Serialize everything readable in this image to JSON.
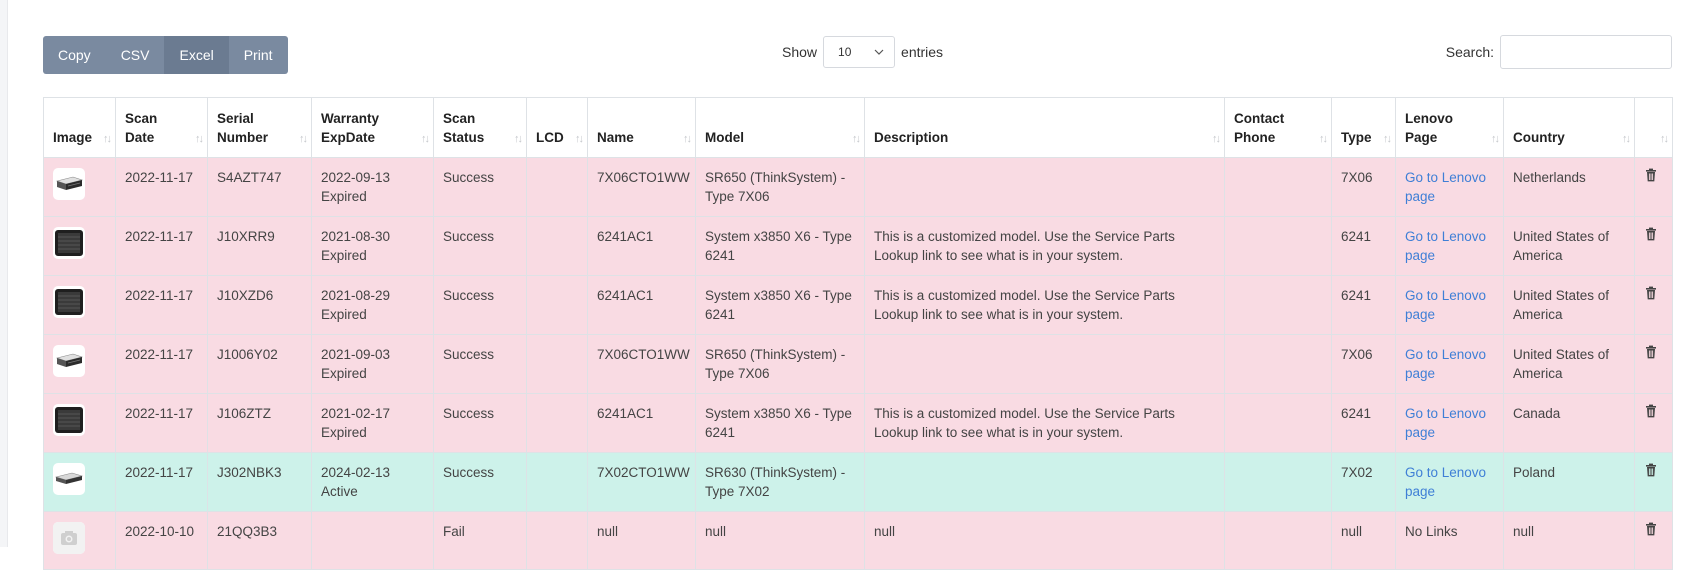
{
  "toolbar": {
    "buttons": [
      "Copy",
      "CSV",
      "Excel",
      "Print"
    ]
  },
  "length": {
    "show_label": "Show",
    "value": "10",
    "entries_label": "entries"
  },
  "search": {
    "label": "Search:",
    "value": ""
  },
  "table": {
    "headers": [
      "Image",
      "Scan Date",
      "Serial Number",
      "Warranty ExpDate",
      "Scan Status",
      "LCD",
      "Name",
      "Model",
      "Description",
      "Contact Phone",
      "Type",
      "Lenovo Page",
      "Country",
      ""
    ],
    "rows": [
      {
        "status": "expired",
        "image": "rack-server-light",
        "scan_date": "2022-11-17",
        "serial": "S4AZT747",
        "warranty": "2022-09-13",
        "warranty_state": "Expired",
        "scan_status": "Success",
        "lcd": "",
        "name": "7X06CTO1WW",
        "model": "SR650 (ThinkSystem) - Type 7X06",
        "description": "",
        "phone": "",
        "type": "7X06",
        "lenovo": "Go to Lenovo page",
        "lenovo_link": true,
        "country": "Netherlands"
      },
      {
        "status": "expired",
        "image": "server-dark",
        "scan_date": "2022-11-17",
        "serial": "J10XRR9",
        "warranty": "2021-08-30",
        "warranty_state": "Expired",
        "scan_status": "Success",
        "lcd": "",
        "name": "6241AC1",
        "model": "System x3850 X6 - Type 6241",
        "description": "This is a customized model. Use the Service Parts Lookup link to see what is in your system.",
        "phone": "",
        "type": "6241",
        "lenovo": "Go to Lenovo page",
        "lenovo_link": true,
        "country": "United States of America"
      },
      {
        "status": "expired",
        "image": "server-dark",
        "scan_date": "2022-11-17",
        "serial": "J10XZD6",
        "warranty": "2021-08-29",
        "warranty_state": "Expired",
        "scan_status": "Success",
        "lcd": "",
        "name": "6241AC1",
        "model": "System x3850 X6 - Type 6241",
        "description": "This is a customized model. Use the Service Parts Lookup link to see what is in your system.",
        "phone": "",
        "type": "6241",
        "lenovo": "Go to Lenovo page",
        "lenovo_link": true,
        "country": "United States of America"
      },
      {
        "status": "expired",
        "image": "rack-server-light",
        "scan_date": "2022-11-17",
        "serial": "J1006Y02",
        "warranty": "2021-09-03",
        "warranty_state": "Expired",
        "scan_status": "Success",
        "lcd": "",
        "name": "7X06CTO1WW",
        "model": "SR650 (ThinkSystem) - Type 7X06",
        "description": "",
        "phone": "",
        "type": "7X06",
        "lenovo": "Go to Lenovo page",
        "lenovo_link": true,
        "country": "United States of America"
      },
      {
        "status": "expired",
        "image": "server-dark",
        "scan_date": "2022-11-17",
        "serial": "J106ZTZ",
        "warranty": "2021-02-17",
        "warranty_state": "Expired",
        "scan_status": "Success",
        "lcd": "",
        "name": "6241AC1",
        "model": "System x3850 X6 - Type 6241",
        "description": "This is a customized model. Use the Service Parts Lookup link to see what is in your system.",
        "phone": "",
        "type": "6241",
        "lenovo": "Go to Lenovo page",
        "lenovo_link": true,
        "country": "Canada"
      },
      {
        "status": "active",
        "image": "rack-server-slim",
        "scan_date": "2022-11-17",
        "serial": "J302NBK3",
        "warranty": "2024-02-13",
        "warranty_state": "Active",
        "scan_status": "Success",
        "lcd": "",
        "name": "7X02CTO1WW",
        "model": "SR630 (ThinkSystem) - Type 7X02",
        "description": "",
        "phone": "",
        "type": "7X02",
        "lenovo": "Go to Lenovo page",
        "lenovo_link": true,
        "country": "Poland"
      },
      {
        "status": "expired",
        "image": "camera-placeholder",
        "scan_date": "2022-10-10",
        "serial": "21QQ3B3",
        "warranty": "",
        "warranty_state": "",
        "scan_status": "Fail",
        "lcd": "",
        "name": "null",
        "model": "null",
        "description": "null",
        "phone": "",
        "type": "null",
        "lenovo": "No Links",
        "lenovo_link": false,
        "country": "null"
      }
    ]
  },
  "colors": {
    "expired_row": "#f9dbe3",
    "active_row": "#cdf2ea",
    "button_bg": "#7a8aa0",
    "link": "#3f7fd6"
  },
  "icons": {
    "delete": "trash-icon",
    "sort": "sort-icon",
    "dropdown": "chevron-down-icon"
  }
}
